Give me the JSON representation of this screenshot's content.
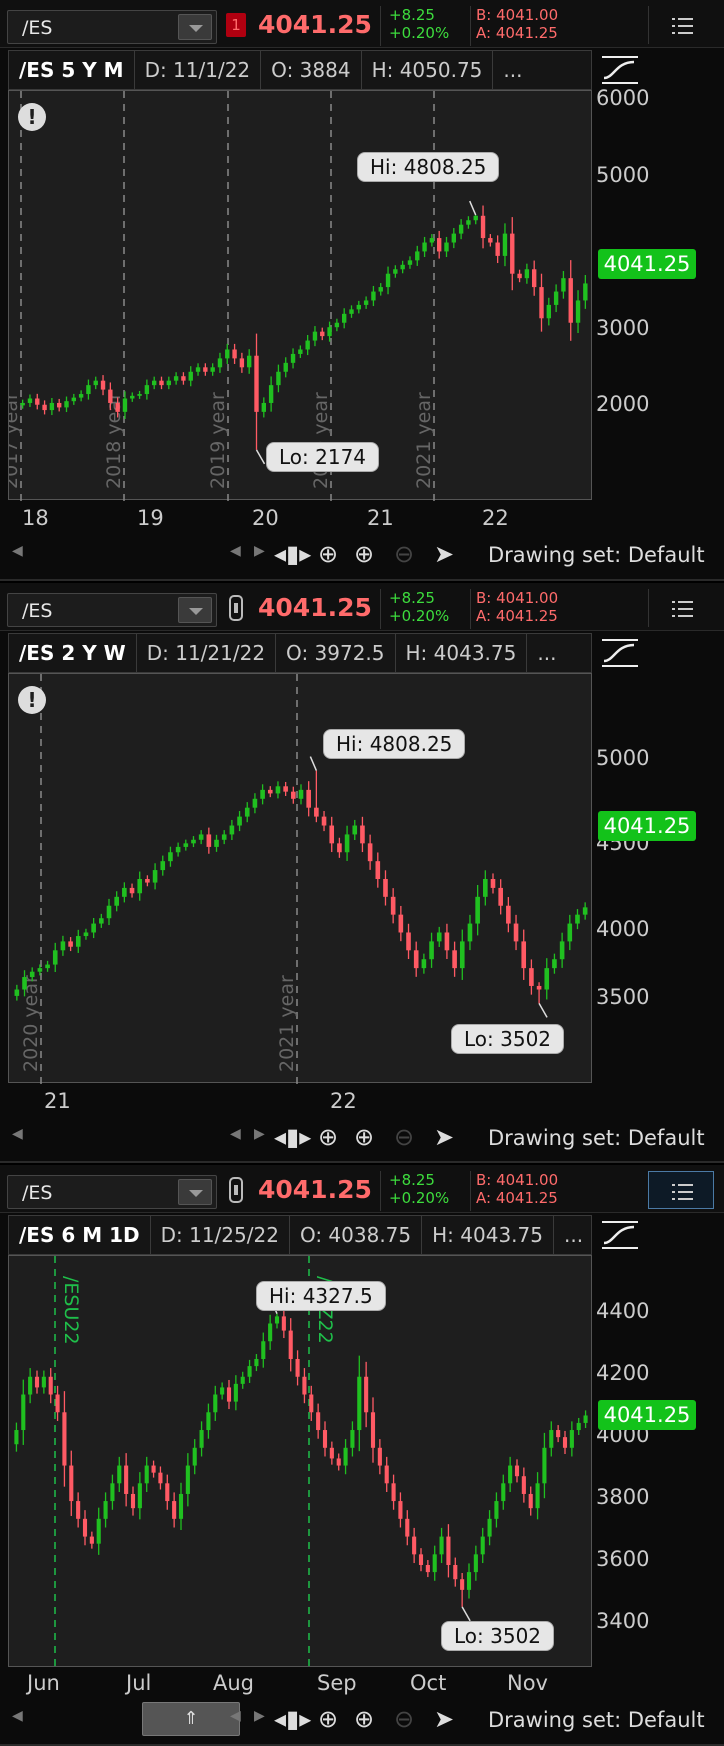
{
  "panels": [
    {
      "symbol": "/ES",
      "indicator": "1",
      "price": "4041.25",
      "change": "+8.25",
      "change_pct": "+0.20%",
      "bid": "B: 4041.00",
      "ask": "A: 4041.25",
      "header": {
        "title": "/ES 5 Y M",
        "date": "D: 11/1/22",
        "open": "O: 3884",
        "high": "H: 4050.75",
        "more": "..."
      },
      "yaxis": [
        "6000",
        "5000",
        "3000",
        "2000"
      ],
      "last_price_label": "4041.25",
      "xaxis": [
        "18",
        "19",
        "20",
        "21",
        "22"
      ],
      "year_markers": [
        "2017 year",
        "2018 year",
        "2019 year",
        "2020 year",
        "2021 year"
      ],
      "hi_label": "Hi: 4808.25",
      "lo_label": "Lo: 2174",
      "drawing_set": "Drawing set: Default"
    },
    {
      "symbol": "/ES",
      "price": "4041.25",
      "change": "+8.25",
      "change_pct": "+0.20%",
      "bid": "B: 4041.00",
      "ask": "A: 4041.25",
      "header": {
        "title": "/ES 2 Y W",
        "date": "D: 11/21/22",
        "open": "O: 3972.5",
        "high": "H: 4043.75",
        "more": "..."
      },
      "yaxis": [
        "5000",
        "4500",
        "4000",
        "3500"
      ],
      "last_price_label": "4041.25",
      "xaxis": [
        "21",
        "22"
      ],
      "year_markers": [
        "2020 year",
        "2021 year"
      ],
      "hi_label": "Hi: 4808.25",
      "lo_label": "Lo: 3502",
      "drawing_set": "Drawing set: Default"
    },
    {
      "symbol": "/ES",
      "price": "4041.25",
      "change": "+8.25",
      "change_pct": "+0.20%",
      "bid": "B: 4041.00",
      "ask": "A: 4041.25",
      "header": {
        "title": "/ES 6 M 1D",
        "date": "D: 11/25/22",
        "open": "O: 4038.75",
        "high": "H: 4043.75",
        "more": "..."
      },
      "yaxis": [
        "4400",
        "4200",
        "4000",
        "3800",
        "3600",
        "3400"
      ],
      "last_price_label": "4041.25",
      "xaxis": [
        "Jun",
        "Jul",
        "Aug",
        "Sep",
        "Oct",
        "Nov"
      ],
      "contract_markers": [
        "/ESU22",
        "/ESZ22"
      ],
      "hi_label": "Hi: 4327.5",
      "lo_label": "Lo: 3502",
      "drawing_set": "Drawing set: Default"
    }
  ],
  "colors": {
    "up": "#20c020",
    "down": "#ff5a64",
    "last_price_bg": "#13c21a",
    "price_text": "#ff6b6b",
    "change_text": "#3ddc3d"
  },
  "icons": [
    "menu-icon",
    "studies-icon",
    "alert-icon",
    "link-icon",
    "zoom-in-icon",
    "zoom-out-icon",
    "crosshair-icon",
    "pan-icon",
    "cursor-icon"
  ],
  "chart_data": [
    {
      "type": "candlestick",
      "title": "/ES 5 Y M",
      "ylim": [
        1600,
        6200
      ],
      "yticks": [
        2000,
        3000,
        5000,
        6000
      ],
      "high": 4808.25,
      "low": 2174,
      "last": 4041.25,
      "closes": [
        2700,
        2750,
        2680,
        2620,
        2700,
        2650,
        2720,
        2760,
        2800,
        2900,
        2950,
        2850,
        2700,
        2600,
        2750,
        2780,
        2800,
        2900,
        2950,
        2900,
        2950,
        3000,
        2950,
        3050,
        3100,
        3050,
        3100,
        3200,
        3300,
        3200,
        3100,
        3230,
        2600,
        2700,
        2900,
        3050,
        3150,
        3250,
        3300,
        3400,
        3500,
        3450,
        3550,
        3600,
        3700,
        3750,
        3800,
        3850,
        3950,
        4000,
        4150,
        4200,
        4250,
        4300,
        4400,
        4500,
        4550,
        4400,
        4500,
        4600,
        4700,
        4750,
        4800,
        4550,
        4500,
        4350,
        4600,
        4150,
        4100,
        4200,
        4000,
        3650,
        3800,
        3950,
        4100,
        3600,
        3850,
        4041
      ],
      "x_ticks": [
        "18",
        "19",
        "20",
        "21",
        "22"
      ]
    },
    {
      "type": "candlestick",
      "title": "/ES 2 Y W",
      "ylim": [
        3050,
        5350
      ],
      "yticks": [
        3500,
        4000,
        4500,
        5000
      ],
      "high": 4808.25,
      "low": 3502,
      "last": 4041.25,
      "closes": [
        3580,
        3650,
        3680,
        3700,
        3720,
        3800,
        3850,
        3820,
        3880,
        3900,
        3950,
        3980,
        4050,
        4100,
        4150,
        4120,
        4200,
        4180,
        4250,
        4300,
        4350,
        4380,
        4400,
        4420,
        4450,
        4380,
        4420,
        4450,
        4500,
        4550,
        4600,
        4650,
        4700,
        4680,
        4720,
        4690,
        4650,
        4700,
        4600,
        4550,
        4500,
        4400,
        4350,
        4450,
        4500,
        4400,
        4300,
        4200,
        4100,
        4000,
        3900,
        3800,
        3700,
        3750,
        3850,
        3900,
        3800,
        3700,
        3850,
        3950,
        4100,
        4200,
        4150,
        4050,
        3950,
        3850,
        3700,
        3600,
        3580,
        3700,
        3750,
        3850,
        3950,
        4000,
        4041
      ],
      "x_ticks": [
        "21",
        "22"
      ]
    },
    {
      "type": "candlestick",
      "title": "/ES 6 M 1D",
      "ylim": [
        3330,
        4490
      ],
      "yticks": [
        3400,
        3600,
        3800,
        4000,
        4200,
        4400
      ],
      "high": 4327.5,
      "low": 3502,
      "last": 4041.25,
      "closes": [
        4000,
        4100,
        4150,
        4120,
        4150,
        4100,
        4050,
        3900,
        3800,
        3750,
        3700,
        3680,
        3750,
        3800,
        3850,
        3900,
        3820,
        3780,
        3850,
        3900,
        3880,
        3850,
        3800,
        3750,
        3820,
        3900,
        3950,
        4000,
        4050,
        4100,
        4120,
        4080,
        4130,
        4150,
        4180,
        4200,
        4250,
        4300,
        4320,
        4280,
        4200,
        4150,
        4100,
        4050,
        4000,
        3950,
        3920,
        3900,
        3950,
        4000,
        4150,
        4050,
        3950,
        3900,
        3850,
        3800,
        3750,
        3700,
        3650,
        3620,
        3600,
        3650,
        3700,
        3620,
        3580,
        3550,
        3600,
        3650,
        3700,
        3750,
        3800,
        3850,
        3900,
        3870,
        3820,
        3780,
        3850,
        3950,
        4000,
        3980,
        3950,
        4000,
        4020,
        4041
      ],
      "x_ticks": [
        "Jun",
        "Jul",
        "Aug",
        "Sep",
        "Oct",
        "Nov"
      ]
    }
  ]
}
